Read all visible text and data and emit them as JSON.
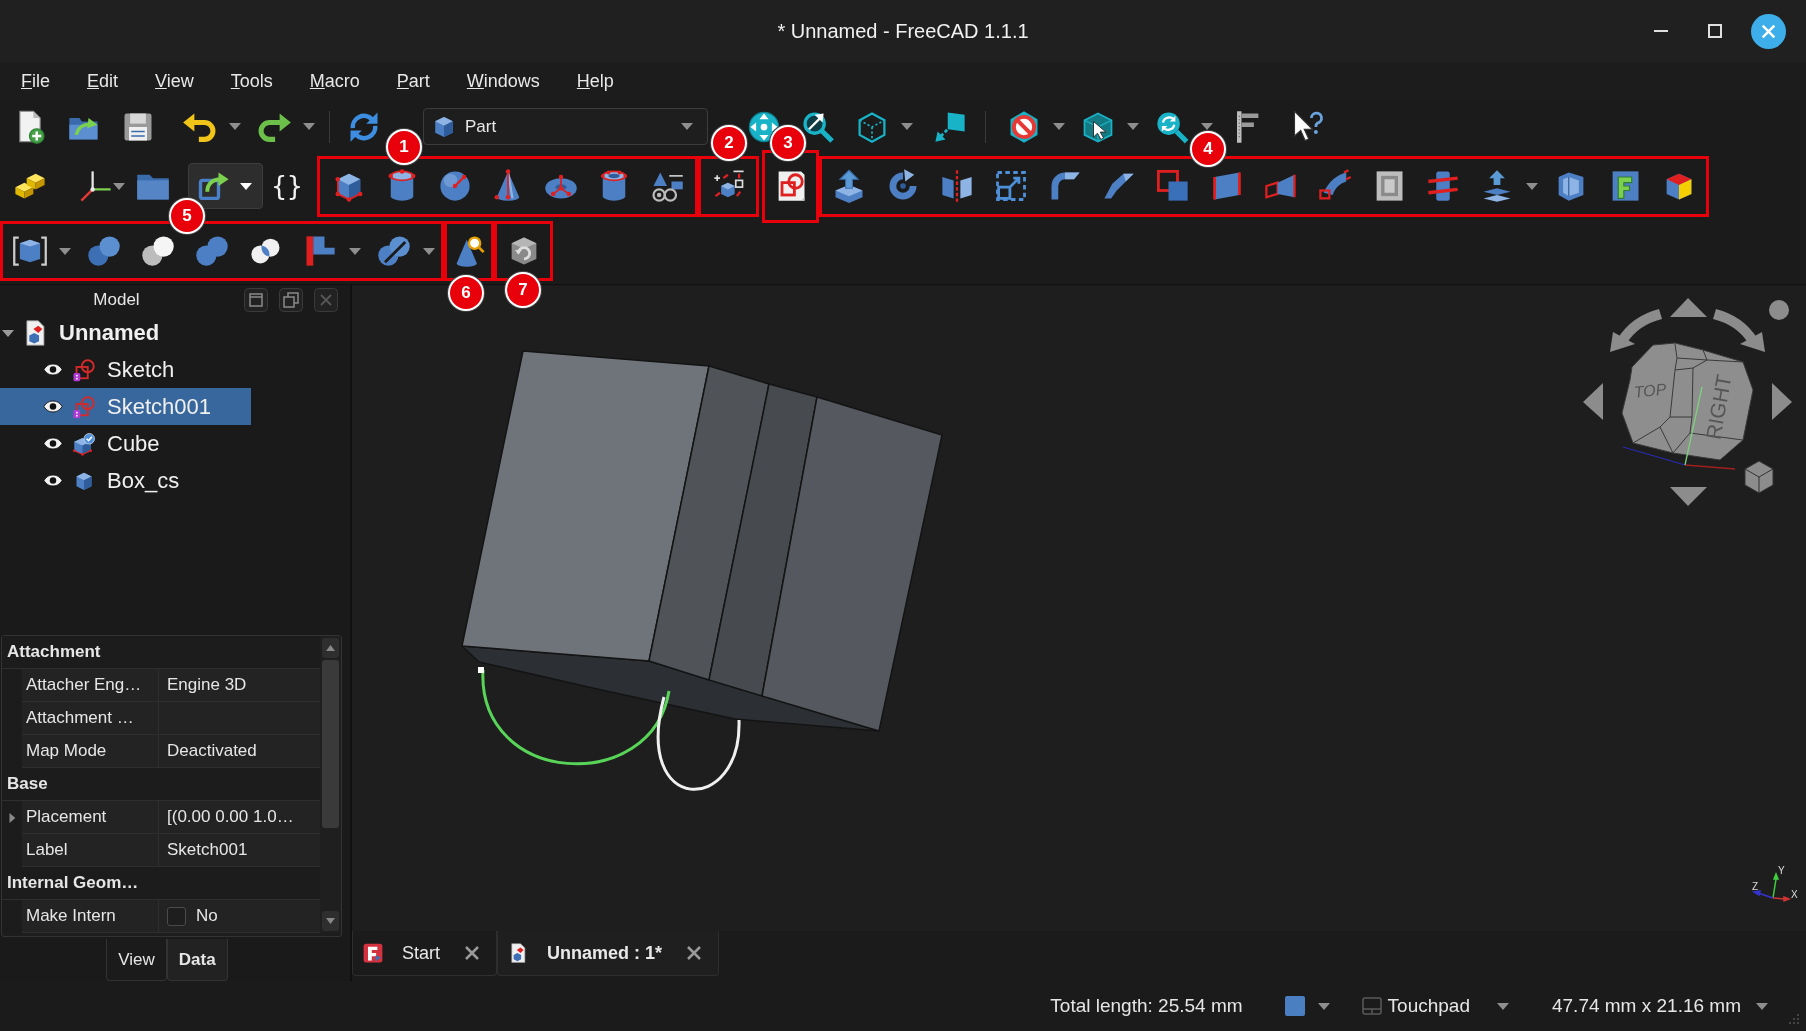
{
  "window": {
    "title": "* Unnamed - FreeCAD 1.1.1"
  },
  "menu": [
    "File",
    "Edit",
    "View",
    "Tools",
    "Macro",
    "Part",
    "Windows",
    "Help"
  ],
  "toolbar": {
    "workbench": "Part",
    "link_button": {
      "pressed": true
    },
    "braces_button": "{}"
  },
  "annotations": [
    {
      "label": "1"
    },
    {
      "label": "2"
    },
    {
      "label": "3"
    },
    {
      "label": "4"
    },
    {
      "label": "5"
    },
    {
      "label": "6"
    },
    {
      "label": "7"
    }
  ],
  "model_panel": {
    "title": "Model",
    "tree": [
      {
        "label": "Unnamed",
        "kind": "document",
        "expanded": true,
        "selected": false,
        "children": [
          {
            "label": "Sketch",
            "kind": "sketch",
            "visible": true,
            "selected": false
          },
          {
            "label": "Sketch001",
            "kind": "sketch",
            "visible": true,
            "selected": true
          },
          {
            "label": "Cube",
            "kind": "feature",
            "visible": true,
            "selected": false
          },
          {
            "label": "Box_cs",
            "kind": "solid",
            "visible": true,
            "selected": false
          }
        ]
      }
    ]
  },
  "properties": {
    "groups": [
      {
        "name": "Attachment",
        "rows": [
          {
            "name": "Attacher Eng…",
            "kind": "text",
            "value": "Engine 3D"
          },
          {
            "name": "Attachment …",
            "kind": "text"
          },
          {
            "name": "Map Mode",
            "kind": "text",
            "value": "Deactivated"
          }
        ]
      },
      {
        "name": "Base",
        "rows": [
          {
            "name": "Placement",
            "kind": "expandable",
            "expanded": false,
            "value": "[(0.00 0.00 1.0…"
          },
          {
            "name": "Label",
            "kind": "text",
            "value": "Sketch001"
          }
        ]
      },
      {
        "name": "Internal Geom…",
        "rows": [
          {
            "name": "Make Intern",
            "kind": "checkbox",
            "checked": false,
            "value": "No"
          }
        ]
      }
    ]
  },
  "property_tabs": [
    {
      "label": "View",
      "selected": false
    },
    {
      "label": "Data",
      "selected": true
    }
  ],
  "viewport": {
    "navigation_cube": {
      "faces": [
        "TOP",
        "RIGHT"
      ]
    },
    "axis_labels": [
      "Z",
      "Y",
      "X"
    ]
  },
  "document_tabs": [
    {
      "label": "Start",
      "kind": "start",
      "selected": false
    },
    {
      "label": "Unnamed : 1*",
      "kind": "document",
      "selected": true
    }
  ],
  "status_bar": {
    "message": "Total length: 25.54 mm",
    "navigation": "Touchpad",
    "dimensions": "47.74 mm x 21.16 mm"
  }
}
